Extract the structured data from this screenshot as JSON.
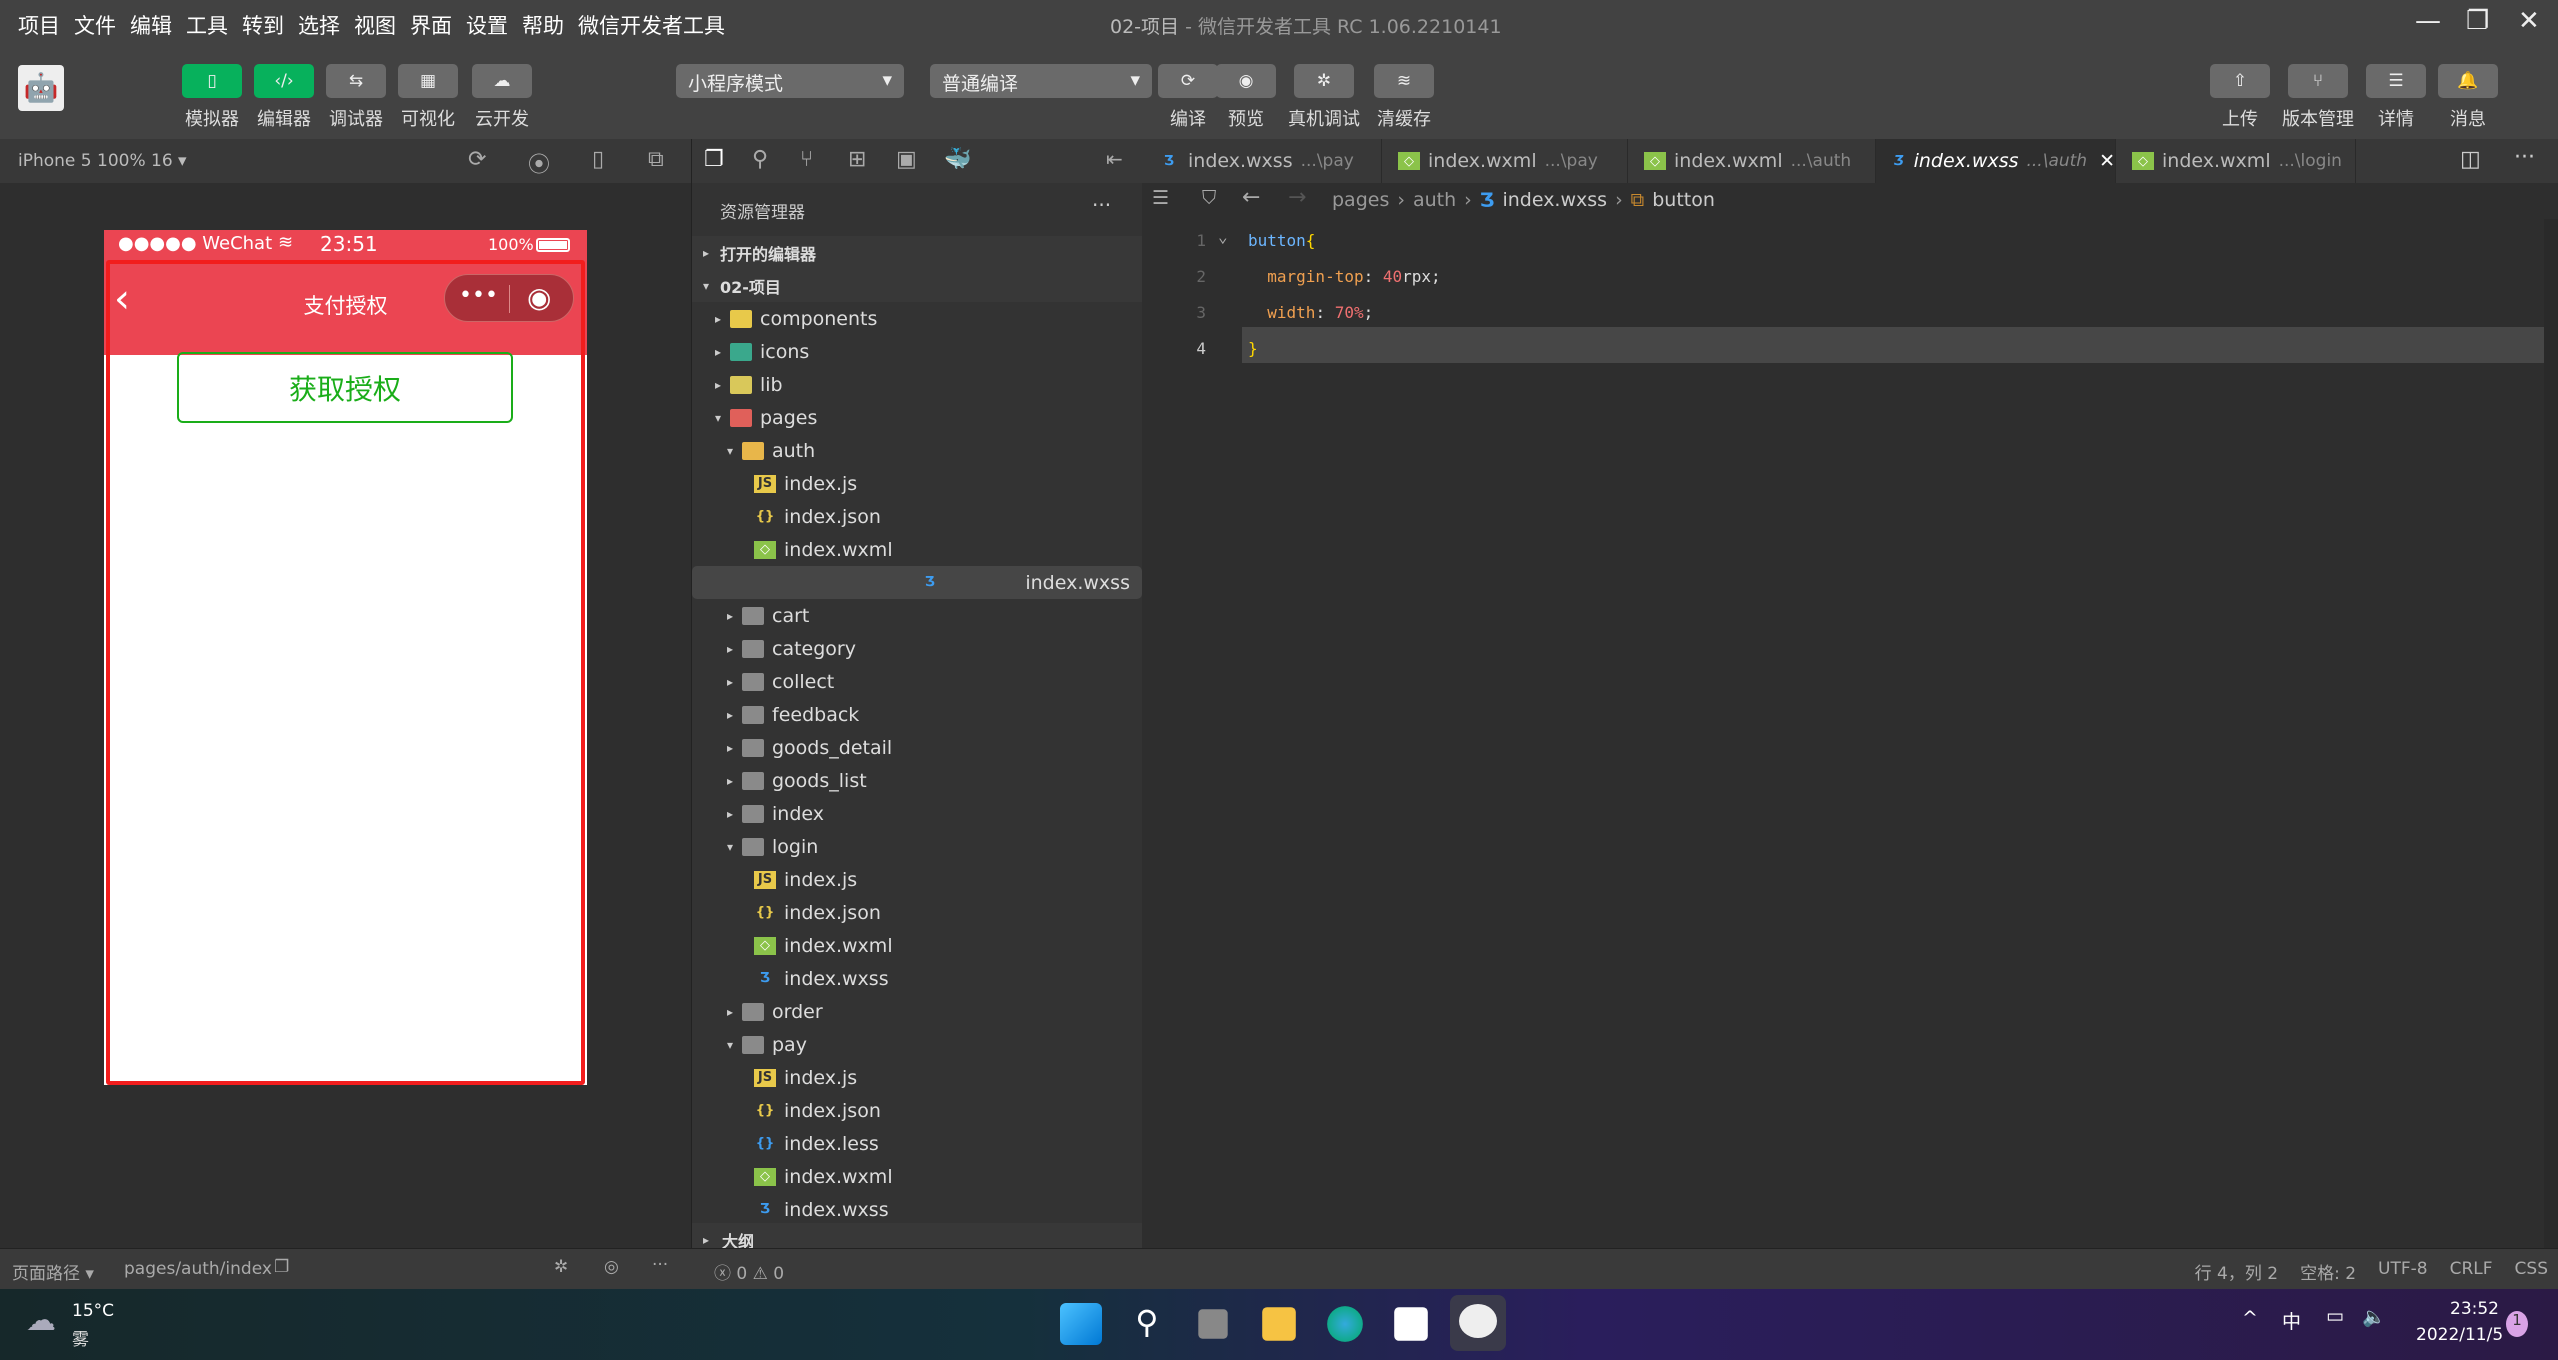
{
  "menu": [
    "项目",
    "文件",
    "编辑",
    "工具",
    "转到",
    "选择",
    "视图",
    "界面",
    "设置",
    "帮助",
    "微信开发者工具"
  ],
  "window_title": {
    "project": "02-项目",
    "rest": " - 微信开发者工具 RC 1.06.2210141"
  },
  "toolbar": {
    "left": [
      "模拟器",
      "编辑器",
      "调试器",
      "可视化",
      "云开发"
    ],
    "mode": "小程序模式",
    "compile": "普通编译",
    "mid": [
      "编译",
      "预览",
      "真机调试",
      "清缓存"
    ],
    "right": [
      "上传",
      "版本管理",
      "详情",
      "消息"
    ]
  },
  "sim": {
    "device": "iPhone 5 100% 16 ▾",
    "carrier": "●●●●● WeChat",
    "time": "23:51",
    "battery": "100%",
    "nav_title": "支付授权",
    "button": "获取授权"
  },
  "explorer": {
    "title": "资源管理器",
    "more": "···",
    "outline": "大纲",
    "items": [
      {
        "label": "打开的编辑器",
        "d": 0,
        "t": "sec",
        "open": false
      },
      {
        "label": "02-项目",
        "d": 0,
        "t": "sec",
        "open": true
      },
      {
        "label": "components",
        "d": 1,
        "t": "folder",
        "open": false,
        "color": "#e8c94a"
      },
      {
        "label": "icons",
        "d": 1,
        "t": "folder",
        "open": false,
        "color": "#3aa88c"
      },
      {
        "label": "lib",
        "d": 1,
        "t": "folder",
        "open": false,
        "color": "#d9c85a"
      },
      {
        "label": "pages",
        "d": 1,
        "t": "folder",
        "open": true,
        "color": "#e0605a"
      },
      {
        "label": "auth",
        "d": 2,
        "t": "folder",
        "open": true,
        "color": "#e8b64a"
      },
      {
        "label": "index.js",
        "d": 3,
        "t": "js"
      },
      {
        "label": "index.json",
        "d": 3,
        "t": "json"
      },
      {
        "label": "index.wxml",
        "d": 3,
        "t": "wxml"
      },
      {
        "label": "index.wxss",
        "d": 3,
        "t": "wxss",
        "selected": true
      },
      {
        "label": "cart",
        "d": 2,
        "t": "folder",
        "open": false
      },
      {
        "label": "category",
        "d": 2,
        "t": "folder",
        "open": false
      },
      {
        "label": "collect",
        "d": 2,
        "t": "folder",
        "open": false
      },
      {
        "label": "feedback",
        "d": 2,
        "t": "folder",
        "open": false
      },
      {
        "label": "goods_detail",
        "d": 2,
        "t": "folder",
        "open": false
      },
      {
        "label": "goods_list",
        "d": 2,
        "t": "folder",
        "open": false
      },
      {
        "label": "index",
        "d": 2,
        "t": "folder",
        "open": false
      },
      {
        "label": "login",
        "d": 2,
        "t": "folder",
        "open": true
      },
      {
        "label": "index.js",
        "d": 3,
        "t": "js"
      },
      {
        "label": "index.json",
        "d": 3,
        "t": "json"
      },
      {
        "label": "index.wxml",
        "d": 3,
        "t": "wxml"
      },
      {
        "label": "index.wxss",
        "d": 3,
        "t": "wxss"
      },
      {
        "label": "order",
        "d": 2,
        "t": "folder",
        "open": false
      },
      {
        "label": "pay",
        "d": 2,
        "t": "folder",
        "open": true
      },
      {
        "label": "index.js",
        "d": 3,
        "t": "js"
      },
      {
        "label": "index.json",
        "d": 3,
        "t": "json"
      },
      {
        "label": "index.less",
        "d": 3,
        "t": "less"
      },
      {
        "label": "index.wxml",
        "d": 3,
        "t": "wxml"
      },
      {
        "label": "index.wxss",
        "d": 3,
        "t": "wxss"
      }
    ]
  },
  "tabs": [
    {
      "name": "index.wxss",
      "path": "...\\pay",
      "t": "wxss"
    },
    {
      "name": "index.wxml",
      "path": "...\\pay",
      "t": "wxml"
    },
    {
      "name": "index.wxml",
      "path": "...\\auth",
      "t": "wxml"
    },
    {
      "name": "index.wxss",
      "path": "...\\auth",
      "t": "wxss",
      "active": true
    },
    {
      "name": "index.wxml",
      "path": "...\\login",
      "t": "wxml"
    }
  ],
  "breadcrumb": [
    "pages",
    "auth",
    "index.wxss",
    "button"
  ],
  "code": [
    {
      "n": "1",
      "parts": [
        [
          "button",
          "#6cb6ff"
        ],
        [
          "{",
          "#ffd700"
        ]
      ]
    },
    {
      "n": "2",
      "parts": [
        [
          "  margin-top",
          "#f0a050"
        ],
        [
          ": ",
          "#ddd"
        ],
        [
          "40",
          "#f07070"
        ],
        [
          "rpx;",
          "#ddd"
        ]
      ]
    },
    {
      "n": "3",
      "parts": [
        [
          "  width",
          "#f0a050"
        ],
        [
          ": ",
          "#ddd"
        ],
        [
          "70%",
          "#f07070"
        ],
        [
          ";",
          "#ddd"
        ]
      ]
    },
    {
      "n": "4",
      "parts": [
        [
          "}",
          "#ffd700"
        ]
      ]
    }
  ],
  "bottom": {
    "path_label": "页面路径 ▾",
    "path": "pages/auth/index",
    "problems": "ⓧ 0 ⚠ 0",
    "cursor": "行 4，列 2",
    "spaces": "空格: 2",
    "encoding": "UTF-8",
    "eol": "CRLF",
    "lang": "CSS"
  },
  "taskbar": {
    "temp": "15°C",
    "weather": "雾",
    "ime": "中",
    "time": "23:52",
    "date": "2022/11/5",
    "badge": "1"
  },
  "colors": {
    "accent": "#07b15c",
    "wechat_red": "#eb4552",
    "button_green": "#1aad19"
  }
}
